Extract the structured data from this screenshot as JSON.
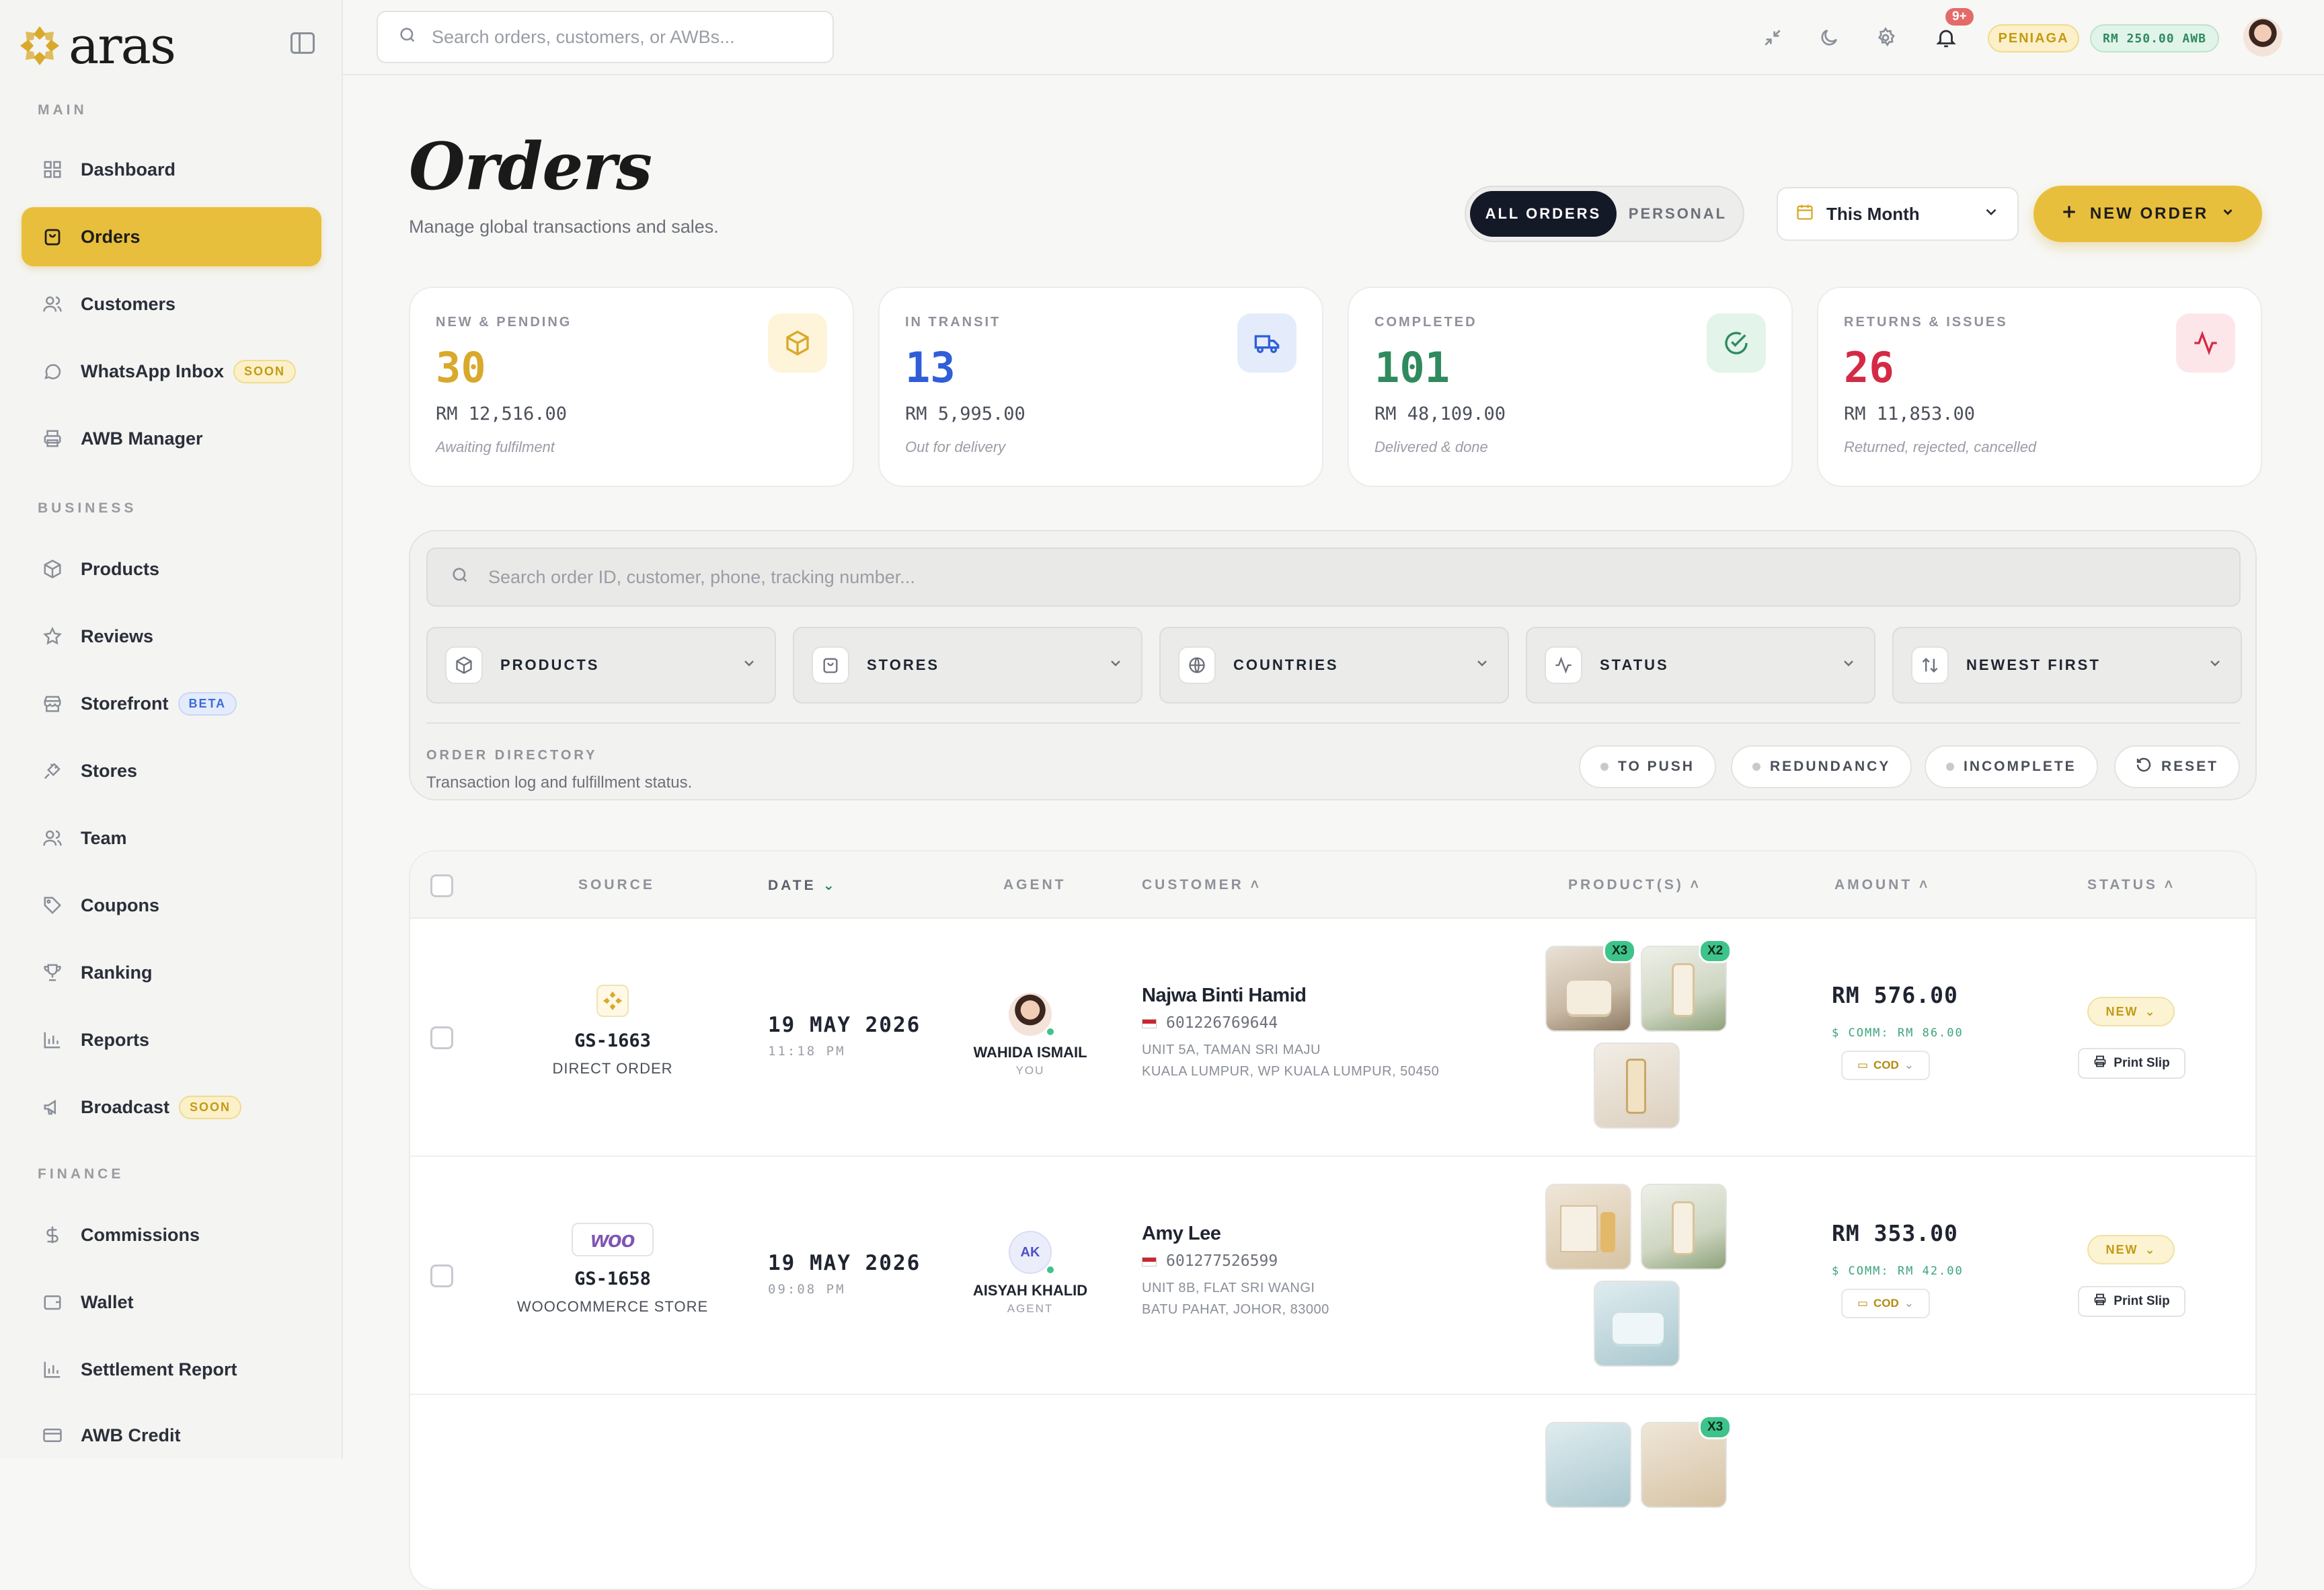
{
  "brand": {
    "name": "aras"
  },
  "sidebar": {
    "sections": [
      {
        "label": "MAIN"
      },
      {
        "label": "BUSINESS"
      },
      {
        "label": "FINANCE"
      }
    ],
    "items": [
      {
        "label": "Dashboard",
        "icon": "grid-icon"
      },
      {
        "label": "Orders",
        "icon": "bag-icon",
        "active": true
      },
      {
        "label": "Customers",
        "icon": "users-icon"
      },
      {
        "label": "WhatsApp Inbox",
        "icon": "chat-icon",
        "badge": "SOON"
      },
      {
        "label": "AWB Manager",
        "icon": "printer-icon"
      },
      {
        "label": "Products",
        "icon": "box-icon"
      },
      {
        "label": "Reviews",
        "icon": "star-icon"
      },
      {
        "label": "Storefront",
        "icon": "store-icon",
        "badge": "BETA"
      },
      {
        "label": "Stores",
        "icon": "plug-icon"
      },
      {
        "label": "Team",
        "icon": "team-icon"
      },
      {
        "label": "Coupons",
        "icon": "tag-icon"
      },
      {
        "label": "Ranking",
        "icon": "trophy-icon"
      },
      {
        "label": "Reports",
        "icon": "chart-icon"
      },
      {
        "label": "Broadcast",
        "icon": "megaphone-icon",
        "badge": "SOON"
      },
      {
        "label": "Commissions",
        "icon": "dollar-icon"
      },
      {
        "label": "Wallet",
        "icon": "wallet-icon"
      },
      {
        "label": "Settlement Report",
        "icon": "report-icon"
      },
      {
        "label": "AWB Credit",
        "icon": "card-icon"
      }
    ]
  },
  "header": {
    "search_placeholder": "Search orders, customers, or AWBs...",
    "notif_count": "9+",
    "role_pill": "PENIAGA",
    "credit_pill": "RM 250.00 AWB"
  },
  "page": {
    "title": "Orders",
    "subtitle": "Manage global transactions and sales.",
    "tabs": [
      "ALL ORDERS",
      "PERSONAL"
    ],
    "period": "This Month",
    "new_order": "NEW ORDER"
  },
  "stats": [
    {
      "label": "NEW & PENDING",
      "value": "30",
      "amount": "RM 12,516.00",
      "note": "Awaiting fulfilment",
      "color": "#d9a92b",
      "icon": "box-icon"
    },
    {
      "label": "IN TRANSIT",
      "value": "13",
      "amount": "RM 5,995.00",
      "note": "Out for delivery",
      "color": "#2f5ed8",
      "icon": "truck-icon"
    },
    {
      "label": "COMPLETED",
      "value": "101",
      "amount": "RM 48,109.00",
      "note": "Delivered & done",
      "color": "#2f8a5e",
      "icon": "check-circle-icon"
    },
    {
      "label": "RETURNS & ISSUES",
      "value": "26",
      "amount": "RM 11,853.00",
      "note": "Returned, rejected, cancelled",
      "color": "#d42a45",
      "icon": "activity-icon"
    }
  ],
  "filters": {
    "search_placeholder": "Search order ID, customer, phone, tracking number...",
    "buttons": [
      "PRODUCTS",
      "STORES",
      "COUNTRIES",
      "STATUS",
      "NEWEST FIRST"
    ],
    "directory_label": "ORDER DIRECTORY",
    "directory_sub": "Transaction log and fulfillment status.",
    "chips": [
      "TO PUSH",
      "REDUNDANCY",
      "INCOMPLETE",
      "RESET"
    ]
  },
  "table": {
    "columns": [
      "SOURCE",
      "DATE",
      "AGENT",
      "CUSTOMER",
      "PRODUCT(S)",
      "AMOUNT",
      "STATUS"
    ],
    "rows": [
      {
        "order_id": "GS-1663",
        "source": "DIRECT ORDER",
        "date": "19 MAY 2026",
        "time": "11:18 PM",
        "agent": "WAHIDA ISMAIL",
        "agent_role": "YOU",
        "customer": "Najwa Binti Hamid",
        "phone": "601226769644",
        "addr1": "UNIT 5A, TAMAN SRI MAJU",
        "addr2": "KUALA LUMPUR, WP KUALA LUMPUR, 50450",
        "qty1": "X3",
        "qty2": "X2",
        "amount": "RM 576.00",
        "comm": "$ COMM: RM 86.00",
        "payment": "COD",
        "status": "NEW",
        "print": "Print Slip"
      },
      {
        "order_id": "GS-1658",
        "source": "WOOCOMMERCE STORE",
        "source_logo": "woo",
        "date": "19 MAY 2026",
        "time": "09:08 PM",
        "agent": "AISYAH KHALID",
        "agent_role": "AGENT",
        "agent_initials": "AK",
        "customer": "Amy Lee",
        "phone": "601277526599",
        "addr1": "UNIT 8B, FLAT SRI WANGI",
        "addr2": "BATU PAHAT, JOHOR, 83000",
        "amount": "RM 353.00",
        "comm": "$ COMM: RM 42.00",
        "payment": "COD",
        "status": "NEW",
        "print": "Print Slip"
      },
      {
        "qty2": "X3"
      }
    ]
  }
}
